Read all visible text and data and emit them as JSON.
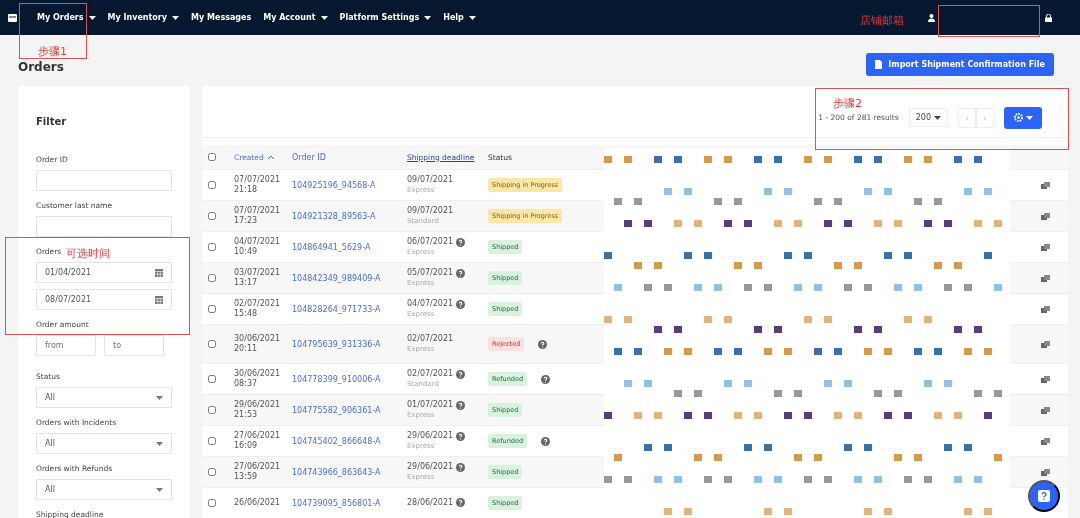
{
  "nav": {
    "items": [
      {
        "label": "My Orders",
        "dropdown": true
      },
      {
        "label": "My Inventory",
        "dropdown": true
      },
      {
        "label": "My Messages",
        "dropdown": false
      },
      {
        "label": "My Account",
        "dropdown": true
      },
      {
        "label": "Platform Settings",
        "dropdown": true
      },
      {
        "label": "Help",
        "dropdown": true
      }
    ]
  },
  "page_title": "Orders",
  "import_button": "Import Shipment Confirmation File",
  "filter": {
    "title": "Filter",
    "fields": [
      {
        "kind": "text",
        "label": "Order ID"
      },
      {
        "kind": "text",
        "label": "Customer last name"
      },
      {
        "kind": "daterange",
        "label": "Orders",
        "from": "01/04/2021",
        "to": "08/07/2021"
      },
      {
        "kind": "range",
        "label": "Order amount",
        "from_placeholder": "from",
        "to_placeholder": "to"
      },
      {
        "kind": "select",
        "label": "Status",
        "value": "All"
      },
      {
        "kind": "select",
        "label": "Orders with Incidents",
        "value": "All"
      },
      {
        "kind": "select",
        "label": "Orders with Refunds",
        "value": "All"
      },
      {
        "kind": "label",
        "label": "Shipping deadline"
      }
    ]
  },
  "pagination": {
    "summary": "1 - 200 of 281 results",
    "per_page": "200",
    "prev": "‹",
    "next": "›"
  },
  "table": {
    "header_checked": false,
    "columns": [
      {
        "label": "Created",
        "kind": "sorted"
      },
      {
        "label": "Order ID",
        "kind": "link"
      },
      {
        "label": "Shipping deadline",
        "kind": "underlined"
      },
      {
        "label": "Status",
        "kind": "plain"
      }
    ],
    "rows": [
      {
        "checked": false,
        "created": "07/07/2021",
        "time": "21:18",
        "order_id": "104925196_94568-A",
        "deadline": "09/07/2021",
        "help": false,
        "method": "Express",
        "status": {
          "label": "Shipping in Progress",
          "kind": "progress"
        },
        "info": false
      },
      {
        "checked": false,
        "created": "07/07/2021",
        "time": "17:23",
        "order_id": "104921328_89563-A",
        "deadline": "09/07/2021",
        "help": false,
        "method": "Standard",
        "status": {
          "label": "Shipping in Progress",
          "kind": "progress"
        },
        "info": false
      },
      {
        "checked": false,
        "created": "04/07/2021",
        "time": "10:49",
        "order_id": "104864941_5629-A",
        "deadline": "06/07/2021",
        "help": true,
        "method": "Express",
        "status": {
          "label": "Shipped",
          "kind": "success"
        },
        "info": false
      },
      {
        "checked": false,
        "created": "03/07/2021",
        "time": "13:17",
        "order_id": "104842349_989409-A",
        "deadline": "05/07/2021",
        "help": true,
        "method": "Express",
        "status": {
          "label": "Shipped",
          "kind": "success"
        },
        "info": false
      },
      {
        "checked": false,
        "created": "02/07/2021",
        "time": "15:48",
        "order_id": "104828264_971733-A",
        "deadline": "04/07/2021",
        "help": true,
        "method": "Express",
        "status": {
          "label": "Shipped",
          "kind": "success"
        },
        "info": false
      },
      {
        "checked": false,
        "created": "30/06/2021",
        "time": "20:11",
        "order_id": "104795639_931336-A",
        "deadline": "02/07/2021",
        "help": false,
        "method": "Express",
        "status": {
          "label": "Rejected",
          "kind": "danger"
        },
        "info": true
      },
      {
        "checked": false,
        "created": "30/06/2021",
        "time": "08:37",
        "order_id": "104778399_910006-A",
        "deadline": "02/07/2021",
        "help": true,
        "method": "Standard",
        "status": {
          "label": "Refunded",
          "kind": "success"
        },
        "info": true
      },
      {
        "checked": false,
        "created": "29/06/2021",
        "time": "21:53",
        "order_id": "104775582_906361-A",
        "deadline": "01/07/2021",
        "help": true,
        "method": "Express",
        "status": {
          "label": "Shipped",
          "kind": "success"
        },
        "info": false
      },
      {
        "checked": false,
        "created": "27/06/2021",
        "time": "16:09",
        "order_id": "104745402_866648-A",
        "deadline": "29/06/2021",
        "help": true,
        "method": "Express",
        "status": {
          "label": "Refunded",
          "kind": "success"
        },
        "info": true
      },
      {
        "checked": false,
        "created": "27/06/2021",
        "time": "13:59",
        "order_id": "104743966_863643-A",
        "deadline": "29/06/2021",
        "help": true,
        "method": "Express",
        "status": {
          "label": "Shipped",
          "kind": "success"
        },
        "info": false
      },
      {
        "checked": false,
        "created": "26/06/2021",
        "time": "",
        "order_id": "104739095_856801-A",
        "deadline": "28/06/2021",
        "help": true,
        "method": "",
        "status": {
          "label": "Shipped",
          "kind": "success"
        },
        "info": false
      }
    ]
  },
  "annotations": [
    {
      "kind": "step1",
      "text": "步骤1"
    },
    {
      "kind": "email",
      "text": "店铺邮箱"
    },
    {
      "kind": "step2",
      "text": "步骤2"
    },
    {
      "kind": "time",
      "text": "可选时间"
    }
  ]
}
